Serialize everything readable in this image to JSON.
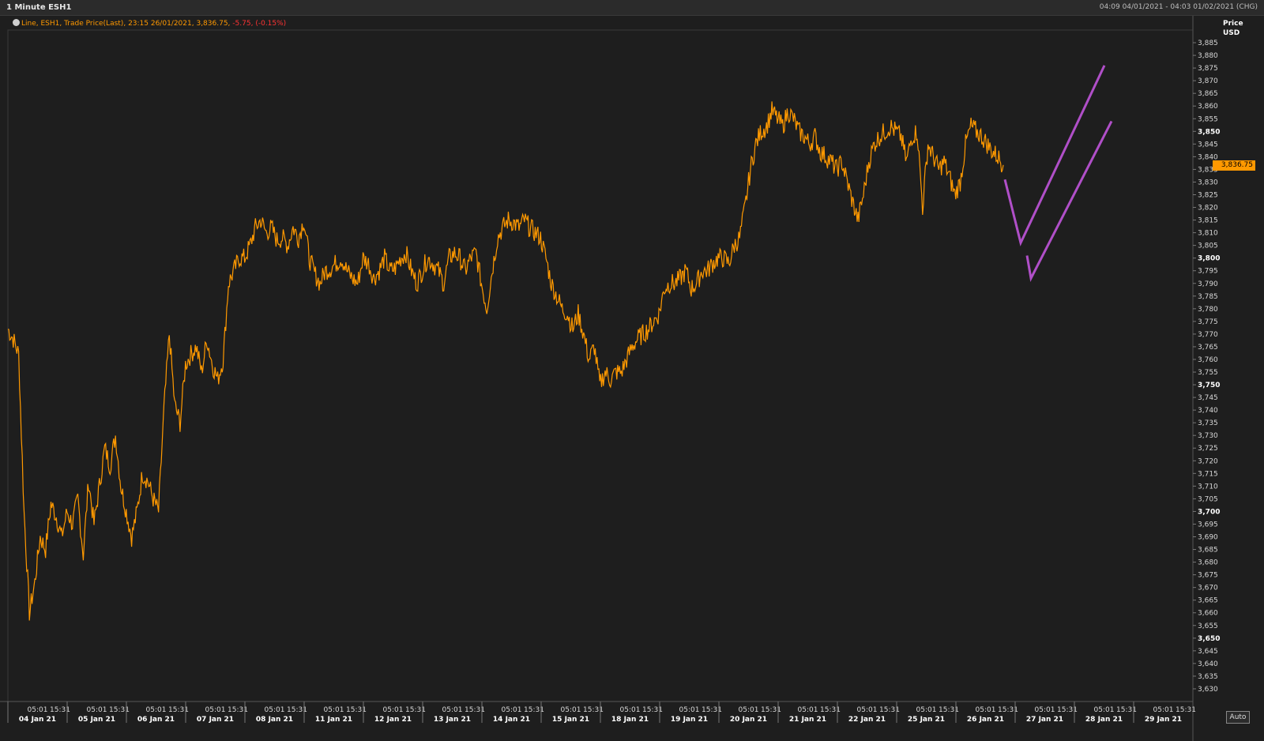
{
  "window": {
    "title": "1 Minute ESH1",
    "date_range": "04:09 04/01/2021 - 04:03 01/02/2021 (CHG)"
  },
  "legend": {
    "icon": "clock-icon",
    "series_label": "Line, ESH1, Trade Price(Last),",
    "timestamp": "23:15 26/01/2021,",
    "last": "3,836.75,",
    "change": "-5.75,",
    "change_pct": "(-0.15%)"
  },
  "y_axis": {
    "title_line1": "Price",
    "title_line2": "USD"
  },
  "last_price_tag": "3,836.75",
  "auto_button": "Auto",
  "colors": {
    "background": "#1e1e1e",
    "series": "#ff9900",
    "annotation": "#b04fc8",
    "negative": "#ff3333",
    "grid": "#2f2f2f"
  },
  "chart_data": {
    "type": "line",
    "title": "1 Minute ESH1",
    "ylim": [
      3625,
      3890
    ],
    "y_ticks": [
      3630,
      3635,
      3640,
      3645,
      3650,
      3655,
      3660,
      3665,
      3670,
      3675,
      3680,
      3685,
      3690,
      3695,
      3700,
      3705,
      3710,
      3715,
      3720,
      3725,
      3730,
      3735,
      3740,
      3745,
      3750,
      3755,
      3760,
      3765,
      3770,
      3775,
      3780,
      3785,
      3790,
      3795,
      3800,
      3805,
      3810,
      3815,
      3820,
      3825,
      3830,
      3835,
      3840,
      3845,
      3850,
      3855,
      3860,
      3865,
      3870,
      3875,
      3880,
      3885
    ],
    "y_tick_labels": [
      "3,630",
      "3,635",
      "3,640",
      "3,645",
      "3,650",
      "3,655",
      "3,660",
      "3,665",
      "3,670",
      "3,675",
      "3,680",
      "3,685",
      "3,690",
      "3,695",
      "3,700",
      "3,705",
      "3,710",
      "3,715",
      "3,720",
      "3,725",
      "3,730",
      "3,735",
      "3,740",
      "3,745",
      "3,750",
      "3,755",
      "3,760",
      "3,765",
      "3,770",
      "3,775",
      "3,780",
      "3,785",
      "3,790",
      "3,795",
      "3,800",
      "3,805",
      "3,810",
      "3,815",
      "3,820",
      "3,825",
      "3,830",
      "3,835",
      "3,840",
      "3,845",
      "3,850",
      "3,855",
      "3,860",
      "3,865",
      "3,870",
      "3,875",
      "3,880",
      "3,885"
    ],
    "y_major_ticks": [
      3650,
      3700,
      3750,
      3800,
      3850
    ],
    "x_days": [
      "04 Jan 21",
      "05 Jan 21",
      "06 Jan 21",
      "07 Jan 21",
      "08 Jan 21",
      "11 Jan 21",
      "12 Jan 21",
      "13 Jan 21",
      "14 Jan 21",
      "15 Jan 21",
      "18 Jan 21",
      "19 Jan 21",
      "20 Jan 21",
      "21 Jan 21",
      "22 Jan 21",
      "25 Jan 21",
      "26 Jan 21",
      "27 Jan 21",
      "28 Jan 21",
      "29 Jan 21"
    ],
    "x_sub_ticks": [
      "05:01",
      "15:31"
    ],
    "series": [
      {
        "values": [
          3772,
          3768,
          3762,
          3700,
          3660,
          3672,
          3690,
          3685,
          3703,
          3698,
          3690,
          3700,
          3695,
          3705,
          3683,
          3712,
          3695,
          3710,
          3725,
          3718,
          3730,
          3710,
          3700,
          3690,
          3700,
          3715,
          3712,
          3705,
          3700,
          3740,
          3770,
          3742,
          3735,
          3758,
          3762,
          3765,
          3755,
          3768,
          3758,
          3752,
          3760,
          3790,
          3795,
          3800,
          3800,
          3805,
          3812,
          3815,
          3810,
          3812,
          3807,
          3808,
          3805,
          3812,
          3808,
          3815,
          3800,
          3794,
          3790,
          3795,
          3796,
          3798,
          3800,
          3795,
          3792,
          3790,
          3800,
          3798,
          3792,
          3795,
          3800,
          3795,
          3796,
          3800,
          3802,
          3795,
          3790,
          3795,
          3800,
          3798,
          3795,
          3790,
          3800,
          3802,
          3800,
          3795,
          3800,
          3802,
          3790,
          3780,
          3795,
          3808,
          3812,
          3815,
          3814,
          3812,
          3815,
          3812,
          3810,
          3808,
          3800,
          3790,
          3785,
          3780,
          3778,
          3772,
          3778,
          3770,
          3760,
          3765,
          3750,
          3755,
          3752,
          3755,
          3755,
          3760,
          3765,
          3768,
          3770,
          3772,
          3775,
          3778,
          3788,
          3790,
          3790,
          3792,
          3795,
          3788,
          3790,
          3795,
          3795,
          3798,
          3800,
          3800,
          3798,
          3805,
          3808,
          3820,
          3835,
          3845,
          3850,
          3852,
          3858,
          3855,
          3852,
          3858,
          3855,
          3850,
          3848,
          3845,
          3848,
          3842,
          3840,
          3838,
          3835,
          3838,
          3830,
          3822,
          3815,
          3825,
          3838,
          3845,
          3848,
          3850,
          3852,
          3850,
          3848,
          3838,
          3848,
          3850,
          3820,
          3845,
          3840,
          3835,
          3838,
          3832,
          3825,
          3830,
          3845,
          3852,
          3850,
          3848,
          3845,
          3842,
          3840,
          3836.75
        ]
      }
    ],
    "annotations": [
      {
        "type": "line",
        "points": [
          [
            3831,
            0
          ],
          [
            3806,
            1
          ],
          [
            3876,
            2
          ]
        ]
      },
      {
        "type": "line",
        "points": [
          [
            3801,
            0
          ],
          [
            3792,
            1
          ],
          [
            3854,
            2
          ]
        ]
      }
    ]
  }
}
